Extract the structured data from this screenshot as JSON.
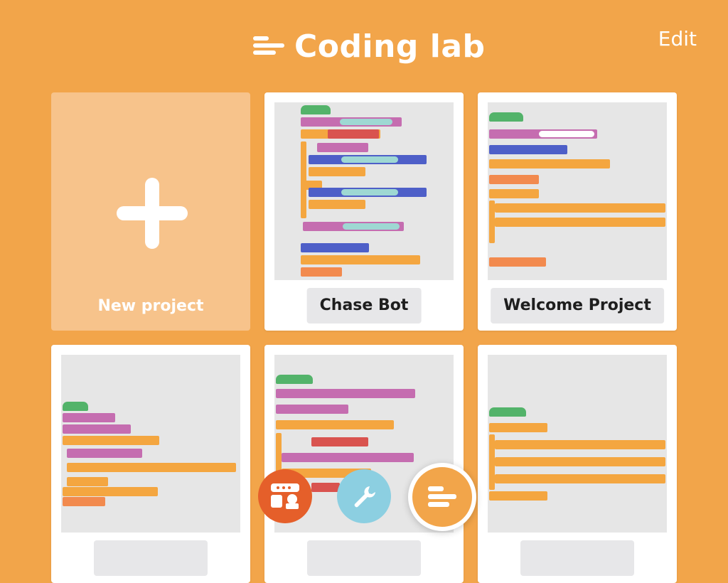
{
  "header": {
    "title": "Coding lab",
    "edit_label": "Edit"
  },
  "projects": [
    {
      "name": "New project",
      "kind": "new"
    },
    {
      "name": "Chase Bot"
    },
    {
      "name": "Welcome Project"
    },
    {
      "name": ""
    },
    {
      "name": ""
    },
    {
      "name": ""
    }
  ],
  "fabs": {
    "blocks_icon": "blocks-icon",
    "tools_icon": "wrench-icon",
    "code_icon": "code-lines-icon"
  },
  "colors": {
    "background": "#F2A54A",
    "card": "#FFFFFF",
    "fab_blocks": "#E55F2A",
    "fab_tools": "#8CCFE1",
    "fab_code": "#F2A54A"
  }
}
